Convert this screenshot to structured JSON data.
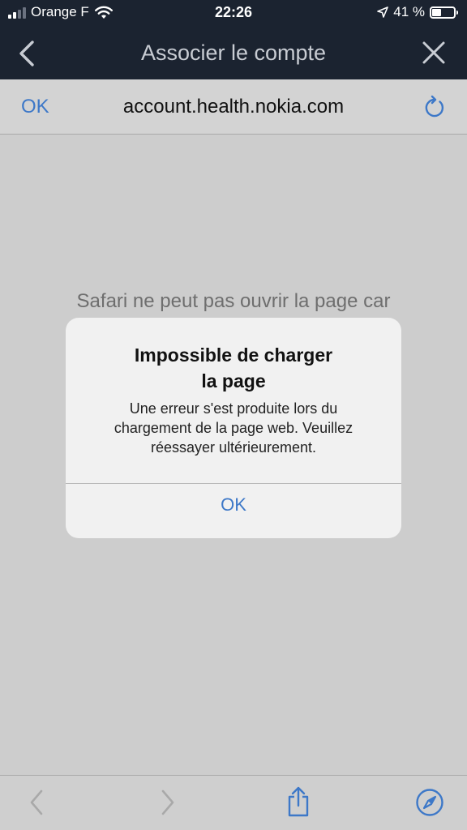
{
  "status_bar": {
    "carrier": "Orange F",
    "time": "22:26",
    "battery_percent": "41 %",
    "battery_level": 0.41,
    "signal_bars": 4,
    "signal_bars_active": 2
  },
  "nav": {
    "title": "Associer le compte",
    "back_icon": "chevron-left-icon",
    "close_icon": "close-icon"
  },
  "url_bar": {
    "done_label": "OK",
    "url": "account.health.nokia.com",
    "reload_icon": "reload-icon"
  },
  "content": {
    "safari_message": "Safari ne peut pas ouvrir la page car"
  },
  "alert": {
    "title_line1": "Impossible de charger",
    "title_line2": "la page",
    "message_line1": "Une erreur s'est produite lors du",
    "message_line2": "chargement de la page web. Veuillez",
    "message_line3": "réessayer ultérieurement.",
    "button_label": "OK"
  },
  "toolbar": {
    "icons": [
      "back-icon",
      "forward-icon",
      "share-icon",
      "compass-icon"
    ]
  },
  "colors": {
    "nav_background": "#1b2330",
    "accent": "#3d78c8",
    "content_background": "#cdcdcd"
  }
}
